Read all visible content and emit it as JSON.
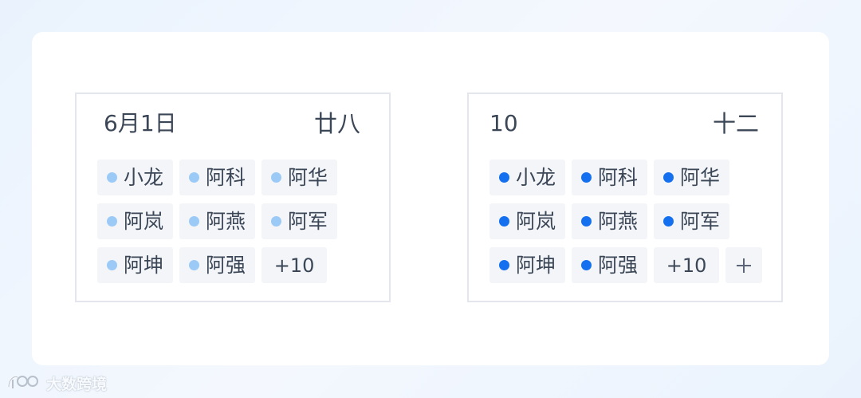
{
  "left_cell": {
    "date": "6月1日",
    "lunar": "廿八",
    "events": [
      "小龙",
      "阿科",
      "阿华",
      "阿岚",
      "阿燕",
      "阿军",
      "阿坤",
      "阿强"
    ],
    "more_label": "+10"
  },
  "right_cell": {
    "date": "10",
    "lunar": "十二",
    "events": [
      "小龙",
      "阿科",
      "阿华",
      "阿岚",
      "阿燕",
      "阿军",
      "阿坤",
      "阿强"
    ],
    "more_label": "+10",
    "add_icon": "plus-icon"
  },
  "colors": {
    "inactive_dot": "#9ccaf6",
    "active_dot": "#1570ef",
    "tag_background": "#f3f5f8",
    "text": "#3b4657"
  },
  "watermark": {
    "text": "大数跨境"
  }
}
